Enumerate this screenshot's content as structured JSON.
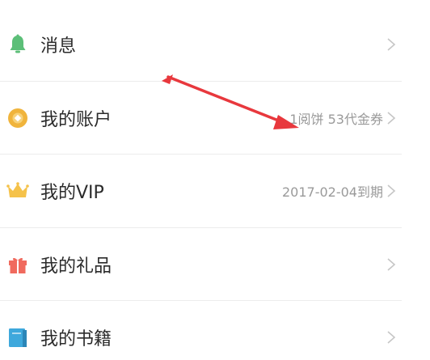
{
  "menu": {
    "items": [
      {
        "label": "消息",
        "value": "",
        "icon": "bell-icon",
        "icon_color": "#5cbf78"
      },
      {
        "label": "我的账户",
        "value": "1阅饼  53代金券",
        "icon": "coin-icon",
        "icon_color": "#f0b43c"
      },
      {
        "label": "我的VIP",
        "value": "2017-02-04到期",
        "icon": "crown-icon",
        "icon_color": "#f5c24a"
      },
      {
        "label": "我的礼品",
        "value": "",
        "icon": "gift-icon",
        "icon_color": "#f06a5e"
      },
      {
        "label": "我的书籍",
        "value": "",
        "icon": "book-icon",
        "icon_color": "#3ea8dc"
      }
    ]
  },
  "colors": {
    "text": "#2b2b2b",
    "secondary_text": "#9a9a9a",
    "divider": "#ececec",
    "annotation_arrow": "#e8383d"
  }
}
